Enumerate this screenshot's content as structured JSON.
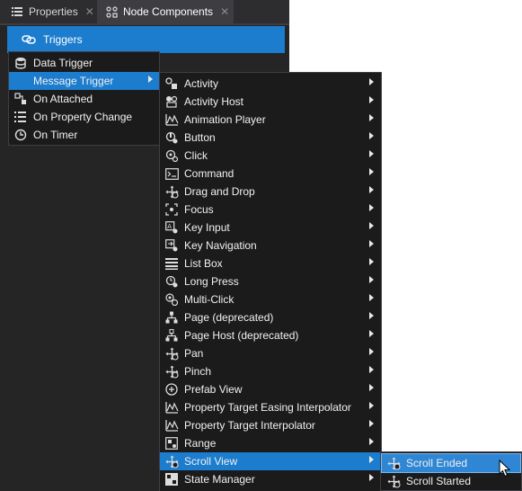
{
  "tabs": [
    {
      "label": "Properties",
      "icon": "list-icon",
      "active": false
    },
    {
      "label": "Node Components",
      "icon": "components-icon",
      "active": true
    }
  ],
  "triggers_button": {
    "label": "Triggers",
    "icon": "add-link-icon"
  },
  "trigger_menu": {
    "items": [
      {
        "label": "Data Trigger",
        "icon": "database-icon",
        "submenu": false
      },
      {
        "label": "Message Trigger",
        "icon": "none",
        "submenu": true,
        "highlighted": true
      },
      {
        "label": "On Attached",
        "icon": "attached-icon",
        "submenu": false
      },
      {
        "label": "On Property Change",
        "icon": "property-change-icon",
        "submenu": false
      },
      {
        "label": "On Timer",
        "icon": "timer-icon",
        "submenu": false
      }
    ]
  },
  "message_menu": {
    "items": [
      {
        "label": "Activity",
        "icon": "activity-icon"
      },
      {
        "label": "Activity Host",
        "icon": "activity-host-icon"
      },
      {
        "label": "Animation Player",
        "icon": "animation-icon"
      },
      {
        "label": "Button",
        "icon": "button-icon"
      },
      {
        "label": "Click",
        "icon": "click-icon"
      },
      {
        "label": "Command",
        "icon": "command-icon"
      },
      {
        "label": "Drag and Drop",
        "icon": "move-icon"
      },
      {
        "label": "Focus",
        "icon": "focus-icon"
      },
      {
        "label": "Key Input",
        "icon": "key-input-icon"
      },
      {
        "label": "Key Navigation",
        "icon": "key-navigation-icon"
      },
      {
        "label": "List Box",
        "icon": "list-box-icon"
      },
      {
        "label": "Long Press",
        "icon": "long-press-icon"
      },
      {
        "label": "Multi-Click",
        "icon": "multi-click-icon"
      },
      {
        "label": "Page (deprecated)",
        "icon": "page-icon"
      },
      {
        "label": "Page Host (deprecated)",
        "icon": "page-host-icon"
      },
      {
        "label": "Pan",
        "icon": "move-icon"
      },
      {
        "label": "Pinch",
        "icon": "move-icon"
      },
      {
        "label": "Prefab View",
        "icon": "prefab-icon"
      },
      {
        "label": "Property Target Easing Interpolator",
        "icon": "animation-icon"
      },
      {
        "label": "Property Target Interpolator",
        "icon": "animation-icon"
      },
      {
        "label": "Range",
        "icon": "range-icon"
      },
      {
        "label": "Scroll View",
        "icon": "move-icon",
        "highlighted": true
      },
      {
        "label": "State Manager",
        "icon": "state-manager-icon"
      }
    ]
  },
  "scroll_menu": {
    "items": [
      {
        "label": "Scroll Ended",
        "icon": "move-icon",
        "highlighted": true
      },
      {
        "label": "Scroll Started",
        "icon": "move-icon"
      }
    ]
  },
  "colors": {
    "accent": "#1c7ccd",
    "panel": "#252526",
    "menu": "#1b1b1c"
  }
}
